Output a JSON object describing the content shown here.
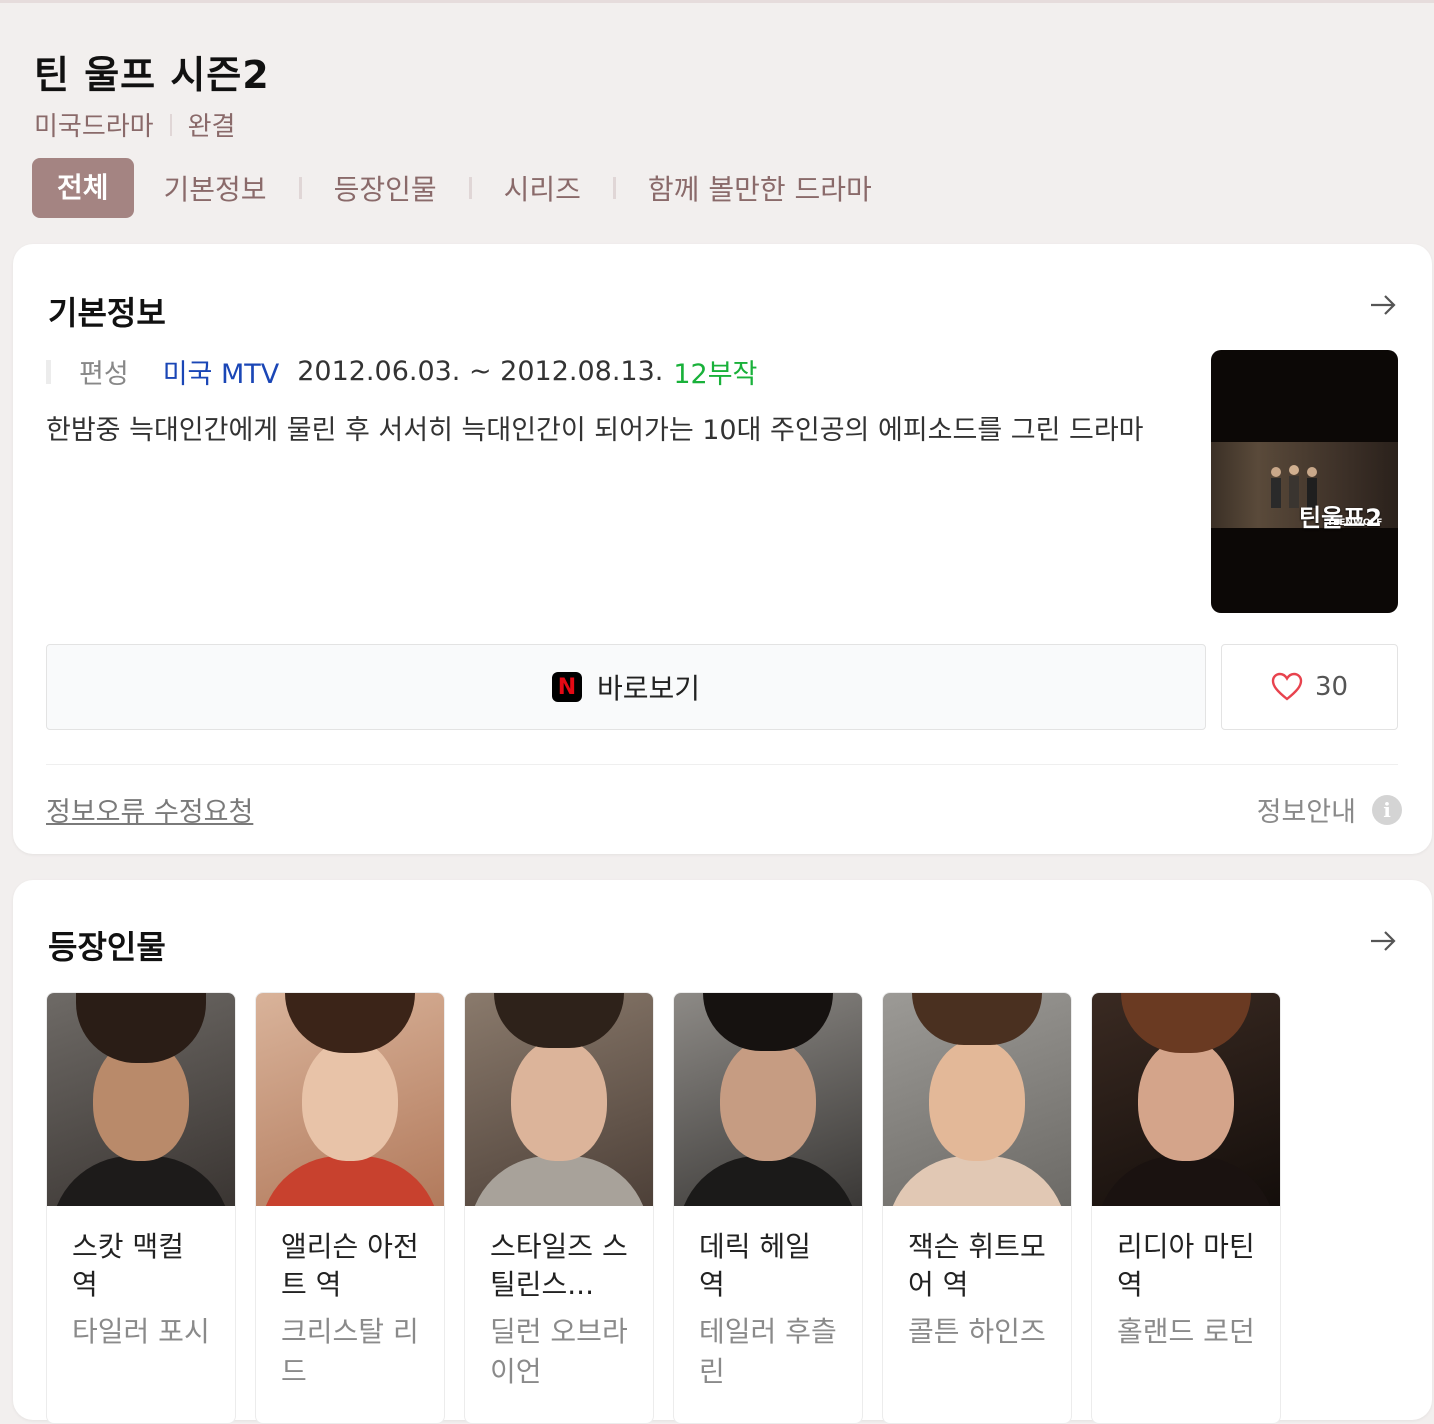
{
  "header": {
    "title": "틴 울프 시즌2",
    "category": "미국드라마",
    "status": "완결"
  },
  "tabs": [
    {
      "label": "전체",
      "active": true
    },
    {
      "label": "기본정보",
      "active": false
    },
    {
      "label": "등장인물",
      "active": false
    },
    {
      "label": "시리즈",
      "active": false
    },
    {
      "label": "함께 볼만한 드라마",
      "active": false
    }
  ],
  "basic_info": {
    "title": "기본정보",
    "schedule_label": "편성",
    "channel": "미국 MTV",
    "dates": "2012.06.03. ~ 2012.08.13.",
    "episodes": "12부작",
    "description": "한밤중 늑대인간에게 물린 후 서서히 늑대인간이 되어가는 10대 주인공의 에피소드를 그린 드라마",
    "poster_logo": "틴울프2",
    "poster_sub": "TEENWOLF",
    "watch_label": "바로보기",
    "watch_icon": "N",
    "like_count": "30",
    "report_link": "정보오류 수정요청",
    "info_guide": "정보안내",
    "info_icon": "i"
  },
  "cast": {
    "title": "등장인물",
    "members": [
      {
        "role": "스캇 맥컬 역",
        "actor": "타일러 포시"
      },
      {
        "role": "앨리슨 아전트 역",
        "actor": "크리스탈 리드"
      },
      {
        "role": "스타일즈 스틸린스...",
        "actor": "딜런 오브라이언"
      },
      {
        "role": "데릭 헤일 역",
        "actor": "테일러 후츨린"
      },
      {
        "role": "잭슨 휘트모어 역",
        "actor": "콜튼 하인즈"
      },
      {
        "role": "리디아 마틴 역",
        "actor": "홀랜드 로던"
      }
    ]
  },
  "colors": {
    "accent": "#a48482",
    "link": "#1a46b6",
    "episodes": "#19b13a",
    "heart": "#e8434e"
  }
}
